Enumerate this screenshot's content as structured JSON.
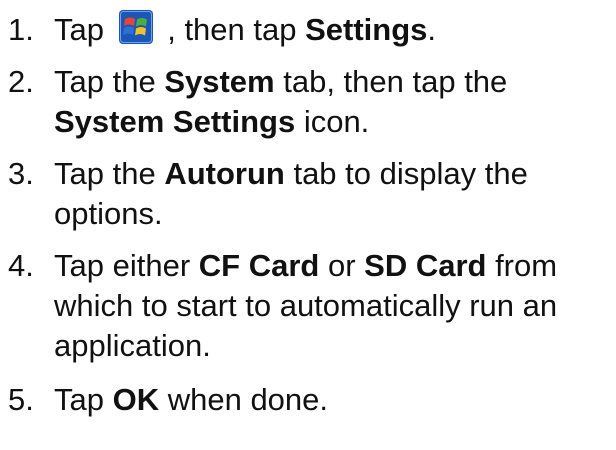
{
  "steps": [
    {
      "number": "1.",
      "text_a": "Tap ",
      "icon": "windows-start-icon",
      "text_b": " , then tap ",
      "bold_a": "Settings",
      "text_c": "."
    },
    {
      "number": "2.",
      "text_a": "Tap the ",
      "bold_a": "System",
      "text_b": " tab, then tap the",
      "bold_b": "System Settings",
      "text_c": " icon."
    },
    {
      "number": "3.",
      "text_a": "Tap the ",
      "bold_a": "Autorun",
      "text_b": " tab to display the",
      "text_c": "options."
    },
    {
      "number": "4.",
      "text_a": "Tap either ",
      "bold_a": "CF Card",
      "text_b": " or ",
      "bold_b": "SD Card",
      "text_c": " from",
      "text_d": "which to start to automatically run an",
      "text_e": "application."
    },
    {
      "number": "5.",
      "text_a": "Tap ",
      "bold_a": "OK",
      "text_b": " when done."
    }
  ],
  "colors": {
    "text": "#111111",
    "icon_red": "#e8452c",
    "icon_green": "#4caf3c",
    "icon_blue": "#2f6fd8",
    "icon_yellow": "#f4c21a",
    "icon_bg": "#1b57b8"
  }
}
